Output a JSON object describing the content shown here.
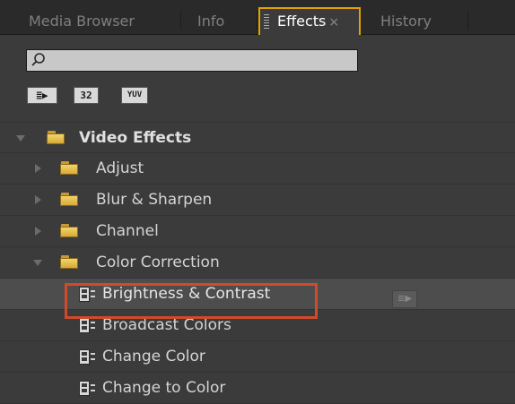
{
  "tabs": [
    {
      "label": "Media Browser",
      "active": false
    },
    {
      "label": "Info",
      "active": false
    },
    {
      "label": "Effects",
      "active": true,
      "close": "×"
    },
    {
      "label": "History",
      "active": false
    }
  ],
  "search": {
    "value": "",
    "placeholder": ""
  },
  "filters": [
    {
      "name": "accelerated-effects",
      "label": "≣▶"
    },
    {
      "name": "32-bit-effects",
      "label": "32"
    },
    {
      "name": "yuv-effects",
      "label": "YUV"
    }
  ],
  "tree": {
    "root": {
      "label": "Video Effects",
      "expanded": true
    },
    "folders": [
      {
        "label": "Adjust",
        "expanded": false
      },
      {
        "label": "Blur & Sharpen",
        "expanded": false
      },
      {
        "label": "Channel",
        "expanded": false
      },
      {
        "label": "Color Correction",
        "expanded": true
      }
    ],
    "effects": [
      {
        "label": "Brightness & Contrast",
        "selected": true,
        "accelerated": true
      },
      {
        "label": "Broadcast Colors",
        "selected": false,
        "accelerated": false
      },
      {
        "label": "Change Color",
        "selected": false,
        "accelerated": false
      },
      {
        "label": "Change to Color",
        "selected": false,
        "accelerated": false
      }
    ]
  },
  "accel_badge": "≣▶",
  "colors": {
    "active_tab_border": "#e2a100",
    "highlight_border": "#d04a2b",
    "folder": "#e8c34f"
  }
}
